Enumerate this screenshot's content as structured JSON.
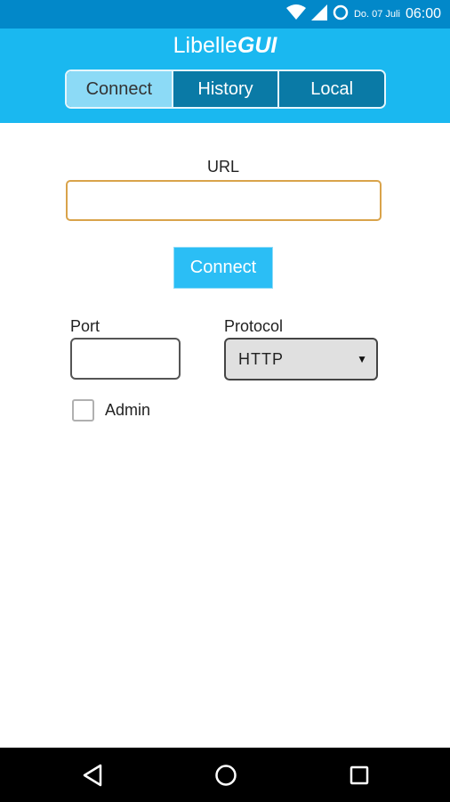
{
  "status_bar": {
    "date": "Do. 07 Juli",
    "time": "06:00",
    "icons": [
      "wifi-icon",
      "signal-icon",
      "sync-circle-icon"
    ]
  },
  "app": {
    "title_regular": "Libelle",
    "title_bold": "GUI"
  },
  "tabs": [
    {
      "label": "Connect",
      "active": true
    },
    {
      "label": "History",
      "active": false
    },
    {
      "label": "Local",
      "active": false
    }
  ],
  "connect_form": {
    "url_label": "URL",
    "url_value": "",
    "url_placeholder": "",
    "connect_button": "Connect",
    "port_label": "Port",
    "port_value": "",
    "protocol_label": "Protocol",
    "protocol_selected": "HTTP",
    "admin_label": "Admin",
    "admin_checked": false
  },
  "nav_bar": {
    "icons": [
      "back-icon",
      "home-icon",
      "recents-icon"
    ]
  },
  "colors": {
    "status_bar": "#0288c9",
    "header": "#1ab8f0",
    "tab_active": "#8cdaf6",
    "tab_inactive": "#0a7aa6",
    "button": "#2bbef5",
    "url_border": "#d9a34a"
  }
}
